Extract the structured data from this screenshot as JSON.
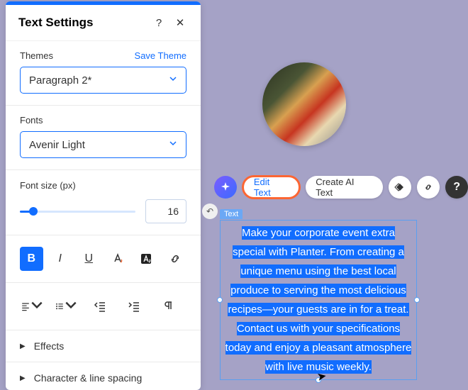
{
  "panel": {
    "title": "Text Settings",
    "themes": {
      "label": "Themes",
      "save": "Save Theme",
      "value": "Paragraph 2*"
    },
    "fonts": {
      "label": "Fonts",
      "value": "Avenir Light"
    },
    "fontsize": {
      "label": "Font size (px)",
      "value": "16"
    },
    "effects": "Effects",
    "charSpacing": "Character & line spacing"
  },
  "toolbar": {
    "editText": "Edit Text",
    "createAI": "Create AI Text"
  },
  "textbox": {
    "label": "Text",
    "content": "Make your corporate event extra special with Planter. From creating a unique menu using the best local produce to serving the most delicious recipes—your guests are in for a treat. Contact us with your specifications today and enjoy a pleasant atmosphere with live music weekly."
  }
}
